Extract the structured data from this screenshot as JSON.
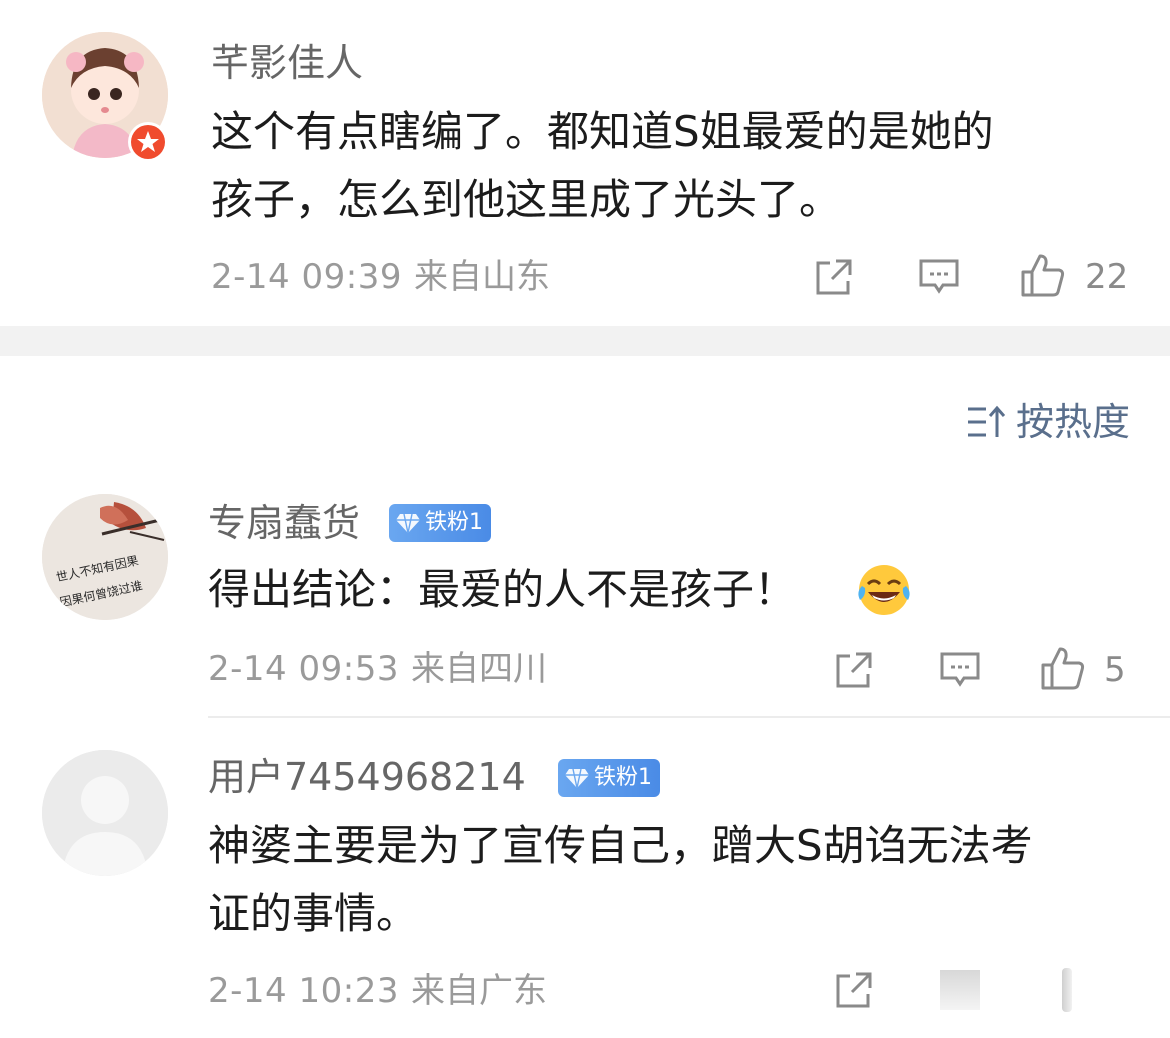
{
  "sort": {
    "label": "按热度"
  },
  "comments": [
    {
      "username": "芊影佳人",
      "text_line1": "这个有点瞎编了。都知道S姐最爱的是她的",
      "text_line2": "孩子，怎么到他这里成了光头了。",
      "time": "2-14 09:39",
      "location": "来自山东",
      "likes": "22"
    },
    {
      "username": "专扇蠢货",
      "badge": "铁粉1",
      "text_line1": "得出结论：最爱的人不是孩子！",
      "time": "2-14 09:53",
      "location": "来自四川",
      "likes": "5",
      "avatar_text1": "世人不知有因果",
      "avatar_text2": "因果何曾饶过谁"
    },
    {
      "username": "用户7454968214",
      "badge": "铁粉1",
      "text_line1": "神婆主要是为了宣传自己，蹭大S胡诌无法考",
      "text_line2": "证的事情。",
      "time": "2-14 10:23",
      "location": "来自广东"
    }
  ],
  "icons": {
    "share": "share-icon",
    "comment": "comment-icon",
    "like": "thumbs-up-icon",
    "laugh": "laughing-crying-emoji"
  },
  "colors": {
    "badge": "#4a8be6",
    "username": "#666666",
    "meta": "#9a9a9a",
    "sort": "#5a6f8c"
  }
}
